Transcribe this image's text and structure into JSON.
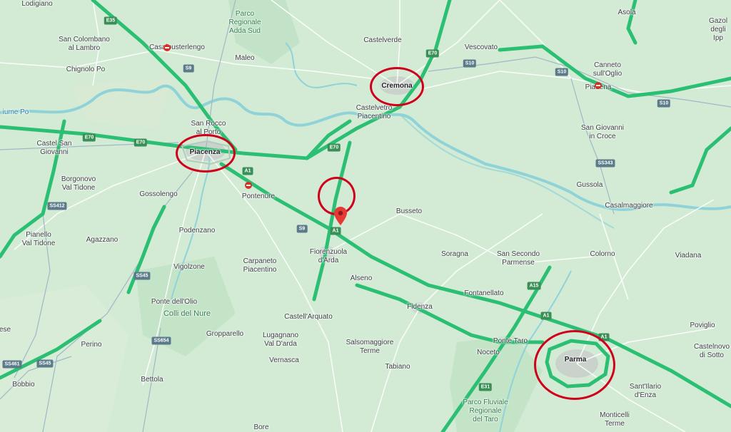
{
  "map": {
    "city_labels": {
      "cremona": "Cremona",
      "piacenza": "Piacenza",
      "parma": "Parma"
    },
    "town_labels": {
      "lodigiano": "Lodigiano",
      "san_colombano": "San Colombano\nal Lambro",
      "casalpusterlengo": "Casalpusterlengo",
      "chignolo": "Chignolo Po",
      "maleo": "Maleo",
      "castelverde": "Castelverde",
      "vescovato": "Vescovato",
      "asola": "Asola",
      "gazoldo": "Gazol\ndegli Ipp",
      "canneto": "Canneto\nsull'Oglio",
      "piadena": "Piadena",
      "castelvetro": "Castelvetro\nPiacentino",
      "san_rocco": "San Rocco\nal Porto",
      "castel_san_giovanni": "Castel San\nGiovanni",
      "san_giovanni_croce": "San Giovanni\nin Croce",
      "borgonovo": "Borgonovo\nVal Tidone",
      "gossolengo": "Gossolengo",
      "pontenure": "Pontenure",
      "gussola": "Gussola",
      "busseto": "Busseto",
      "casalmaggiore": "Casalmaggiore",
      "pianello": "Pianello\nVal Tidone",
      "agazzano": "Agazzano",
      "podenzano": "Podenzano",
      "fiorenzuola": "Fiorenzuola\nd'Arda",
      "soragna": "Soragna",
      "san_secondo": "San Secondo\nParmense",
      "colorno": "Colorno",
      "viadana": "Viadana",
      "vigolzone": "Vigolzone",
      "carpaneto": "Carpaneto\nPiacentino",
      "alseno": "Alseno",
      "fontanellato": "Fontanellato",
      "ponte_dell_olio": "Ponte dell'Olio",
      "fidenza": "Fidenza",
      "castell_arquato": "Castell'Arquato",
      "povigliio": "Poviglio",
      "gropparello": "Gropparello",
      "lugagnano": "Lugagnano\nVal D'arda",
      "salsomaggiore": "Salsomaggiore\nTerme",
      "ponte_taro": "Ponte Taro",
      "noceto": "Noceto",
      "castelnovo": "Castelnovo\ndi Sotto",
      "perino": "Perino",
      "vernasca": "Vernasca",
      "tabiano": "Tabiano",
      "bobbio": "Bobbio",
      "bettola": "Bettola",
      "sant_ilario": "Sant'Ilario\nd'Enza",
      "monticelli": "Monticelli\nTerme",
      "bore": "Bore",
      "ese": "ese"
    },
    "park_labels": {
      "adda_sud": "Parco\nRegionale\nAdda Sud",
      "colli_nure": "Colli del Nure",
      "fluviale_taro": "Parco Fluviale\nRegionale\ndel Taro"
    },
    "water_labels": {
      "fiume_po": "iume Po"
    },
    "road_shields": {
      "e35": "E35",
      "e70_a": "E70",
      "e70_b": "E70",
      "e70_c": "E70",
      "e70_d": "E70",
      "a1_a": "A1",
      "a1_b": "A1",
      "a1_c": "A1",
      "a1_d": "A1",
      "a15": "A15",
      "e31": "E31",
      "s10_a": "S10",
      "s10_b": "S10",
      "s10_c": "S10",
      "s9_a": "S9",
      "s9_b": "S9",
      "s343": "SS343",
      "s412": "SS412",
      "s45_a": "SS45",
      "s45_b": "SS45",
      "s654": "SS654",
      "s461": "SS461"
    },
    "colors": {
      "land": "#cfe8d2",
      "highway": "#2bbf73",
      "river": "#8fd3d8",
      "local_road": "#ffffff",
      "urban": "#c9d3cc",
      "annotation": "#d0021b",
      "pin": "#e53935"
    }
  }
}
